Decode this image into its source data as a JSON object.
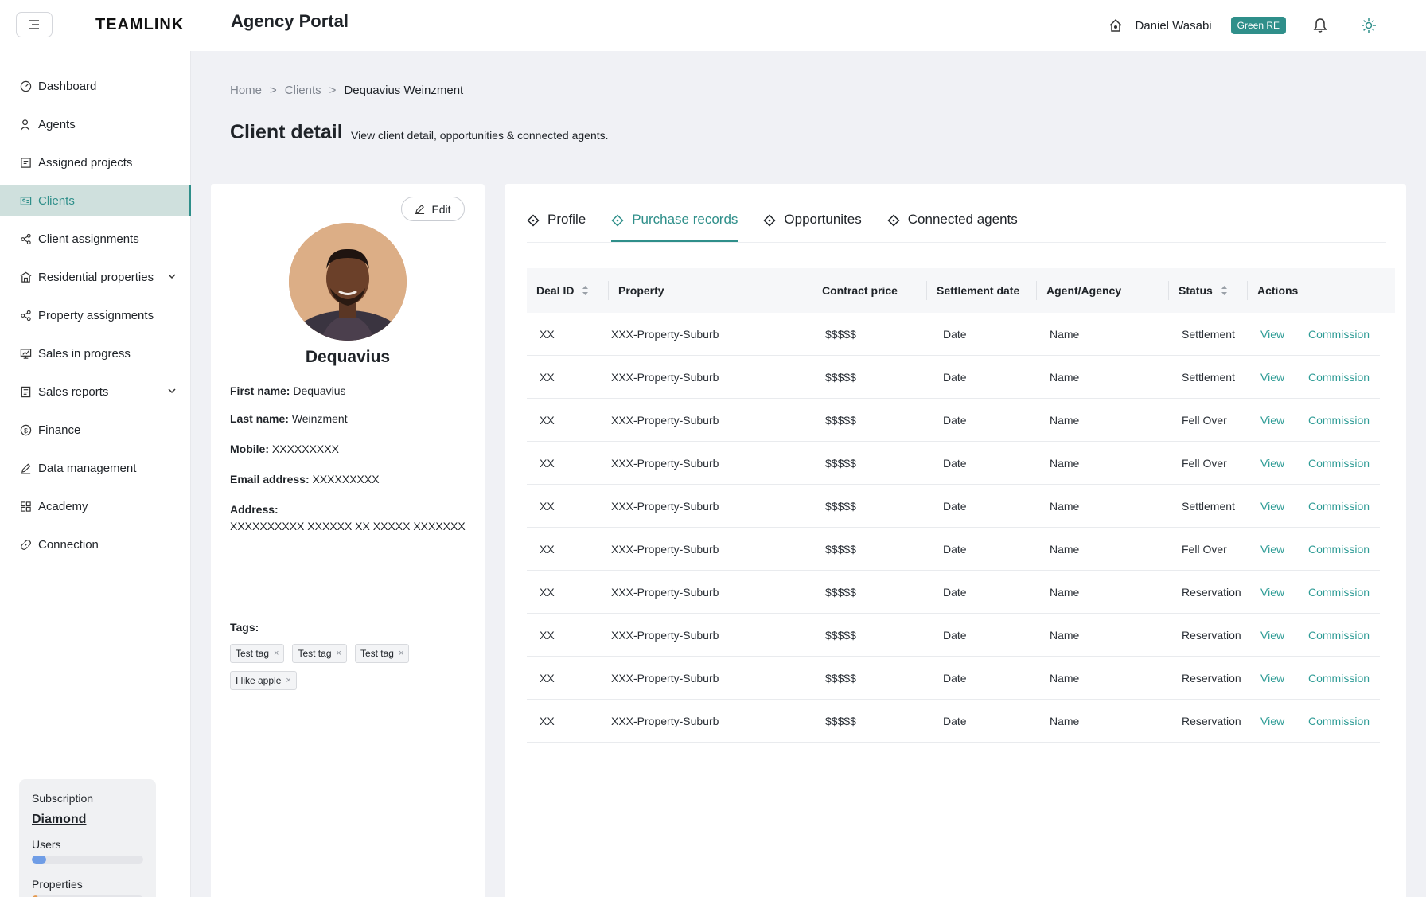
{
  "app": {
    "logo": "TEAMLINK",
    "title": "Agency Portal"
  },
  "header": {
    "user_name": "Daniel Wasabi",
    "org_badge": "Green RE"
  },
  "sidebar": {
    "items": [
      {
        "label": "Dashboard",
        "icon": "dashboard-icon"
      },
      {
        "label": "Agents",
        "icon": "agents-icon"
      },
      {
        "label": "Assigned projects",
        "icon": "projects-icon"
      },
      {
        "label": "Clients",
        "icon": "clients-icon",
        "active": true
      },
      {
        "label": "Client assignments",
        "icon": "share-icon"
      },
      {
        "label": "Residential properties",
        "icon": "building-icon",
        "expandable": true
      },
      {
        "label": "Property assignments",
        "icon": "share-icon"
      },
      {
        "label": "Sales in progress",
        "icon": "presentation-icon"
      },
      {
        "label": "Sales reports",
        "icon": "report-icon",
        "expandable": true
      },
      {
        "label": "Finance",
        "icon": "dollar-icon"
      },
      {
        "label": "Data management",
        "icon": "pen-icon"
      },
      {
        "label": "Academy",
        "icon": "grid-icon"
      },
      {
        "label": "Connection",
        "icon": "link-icon"
      }
    ],
    "subscription": {
      "label": "Subscription",
      "plan": "Diamond",
      "users_label": "Users",
      "users_fraction": 0.13,
      "properties_label": "Properties",
      "properties_fraction": 0.06,
      "users_color": "#6f9de6",
      "properties_color": "#e59a4f"
    }
  },
  "breadcrumb": {
    "home": "Home",
    "sep1": ">",
    "clients": "Clients",
    "sep2": ">",
    "current": "Dequavius Weinzment"
  },
  "page": {
    "title": "Client detail",
    "subtitle": "View client detail, opportunities & connected agents."
  },
  "profile": {
    "edit_label": "Edit",
    "display_name": "Dequavius",
    "first_name_label": "First name:",
    "first_name": "Dequavius",
    "last_name_label": "Last name:",
    "last_name": "Weinzment",
    "mobile_label": "Mobile:",
    "mobile": "XXXXXXXXX",
    "email_label": "Email address:",
    "email": "XXXXXXXXX",
    "address_label": "Address:",
    "address": "XXXXXXXXXX XXXXXX XX XXXXX  XXXXXXX",
    "tags_label": "Tags:",
    "tags": [
      "Test tag",
      "Test tag",
      "Test tag",
      "I like apple"
    ],
    "tag_remove": "×"
  },
  "tabs": [
    {
      "label": "Profile",
      "active": false
    },
    {
      "label": "Purchase records",
      "active": true
    },
    {
      "label": "Opportunites",
      "active": false
    },
    {
      "label": "Connected agents",
      "active": false
    }
  ],
  "table": {
    "columns": [
      "Deal ID",
      "Property",
      "Contract price",
      "Settlement date",
      "Agent/Agency",
      "Status",
      "Actions"
    ],
    "rows": [
      {
        "id": "XX",
        "property": "XXX-Property-Suburb",
        "price": "$$$$$",
        "date": "Date",
        "agent": "Name",
        "status": "Settlement",
        "view": "View",
        "commission": "Commission"
      },
      {
        "id": "XX",
        "property": "XXX-Property-Suburb",
        "price": "$$$$$",
        "date": "Date",
        "agent": "Name",
        "status": "Settlement",
        "view": "View",
        "commission": "Commission"
      },
      {
        "id": "XX",
        "property": "XXX-Property-Suburb",
        "price": "$$$$$",
        "date": "Date",
        "agent": "Name",
        "status": "Fell Over",
        "view": "View",
        "commission": "Commission"
      },
      {
        "id": "XX",
        "property": "XXX-Property-Suburb",
        "price": "$$$$$",
        "date": "Date",
        "agent": "Name",
        "status": "Fell Over",
        "view": "View",
        "commission": "Commission"
      },
      {
        "id": "XX",
        "property": "XXX-Property-Suburb",
        "price": "$$$$$",
        "date": "Date",
        "agent": "Name",
        "status": "Settlement",
        "view": "View",
        "commission": "Commission"
      },
      {
        "id": "XX",
        "property": "XXX-Property-Suburb",
        "price": "$$$$$",
        "date": "Date",
        "agent": "Name",
        "status": "Fell Over",
        "view": "View",
        "commission": "Commission"
      },
      {
        "id": "XX",
        "property": "XXX-Property-Suburb",
        "price": "$$$$$",
        "date": "Date",
        "agent": "Name",
        "status": "Reservation",
        "view": "View",
        "commission": "Commission"
      },
      {
        "id": "XX",
        "property": "XXX-Property-Suburb",
        "price": "$$$$$",
        "date": "Date",
        "agent": "Name",
        "status": "Reservation",
        "view": "View",
        "commission": "Commission"
      },
      {
        "id": "XX",
        "property": "XXX-Property-Suburb",
        "price": "$$$$$",
        "date": "Date",
        "agent": "Name",
        "status": "Reservation",
        "view": "View",
        "commission": "Commission"
      },
      {
        "id": "XX",
        "property": "XXX-Property-Suburb",
        "price": "$$$$$",
        "date": "Date",
        "agent": "Name",
        "status": "Reservation",
        "view": "View",
        "commission": "Commission"
      }
    ]
  },
  "colors": {
    "accent": "#2f8f8a",
    "active_nav_bg": "#cfe0dd",
    "link": "#2f9c96"
  }
}
